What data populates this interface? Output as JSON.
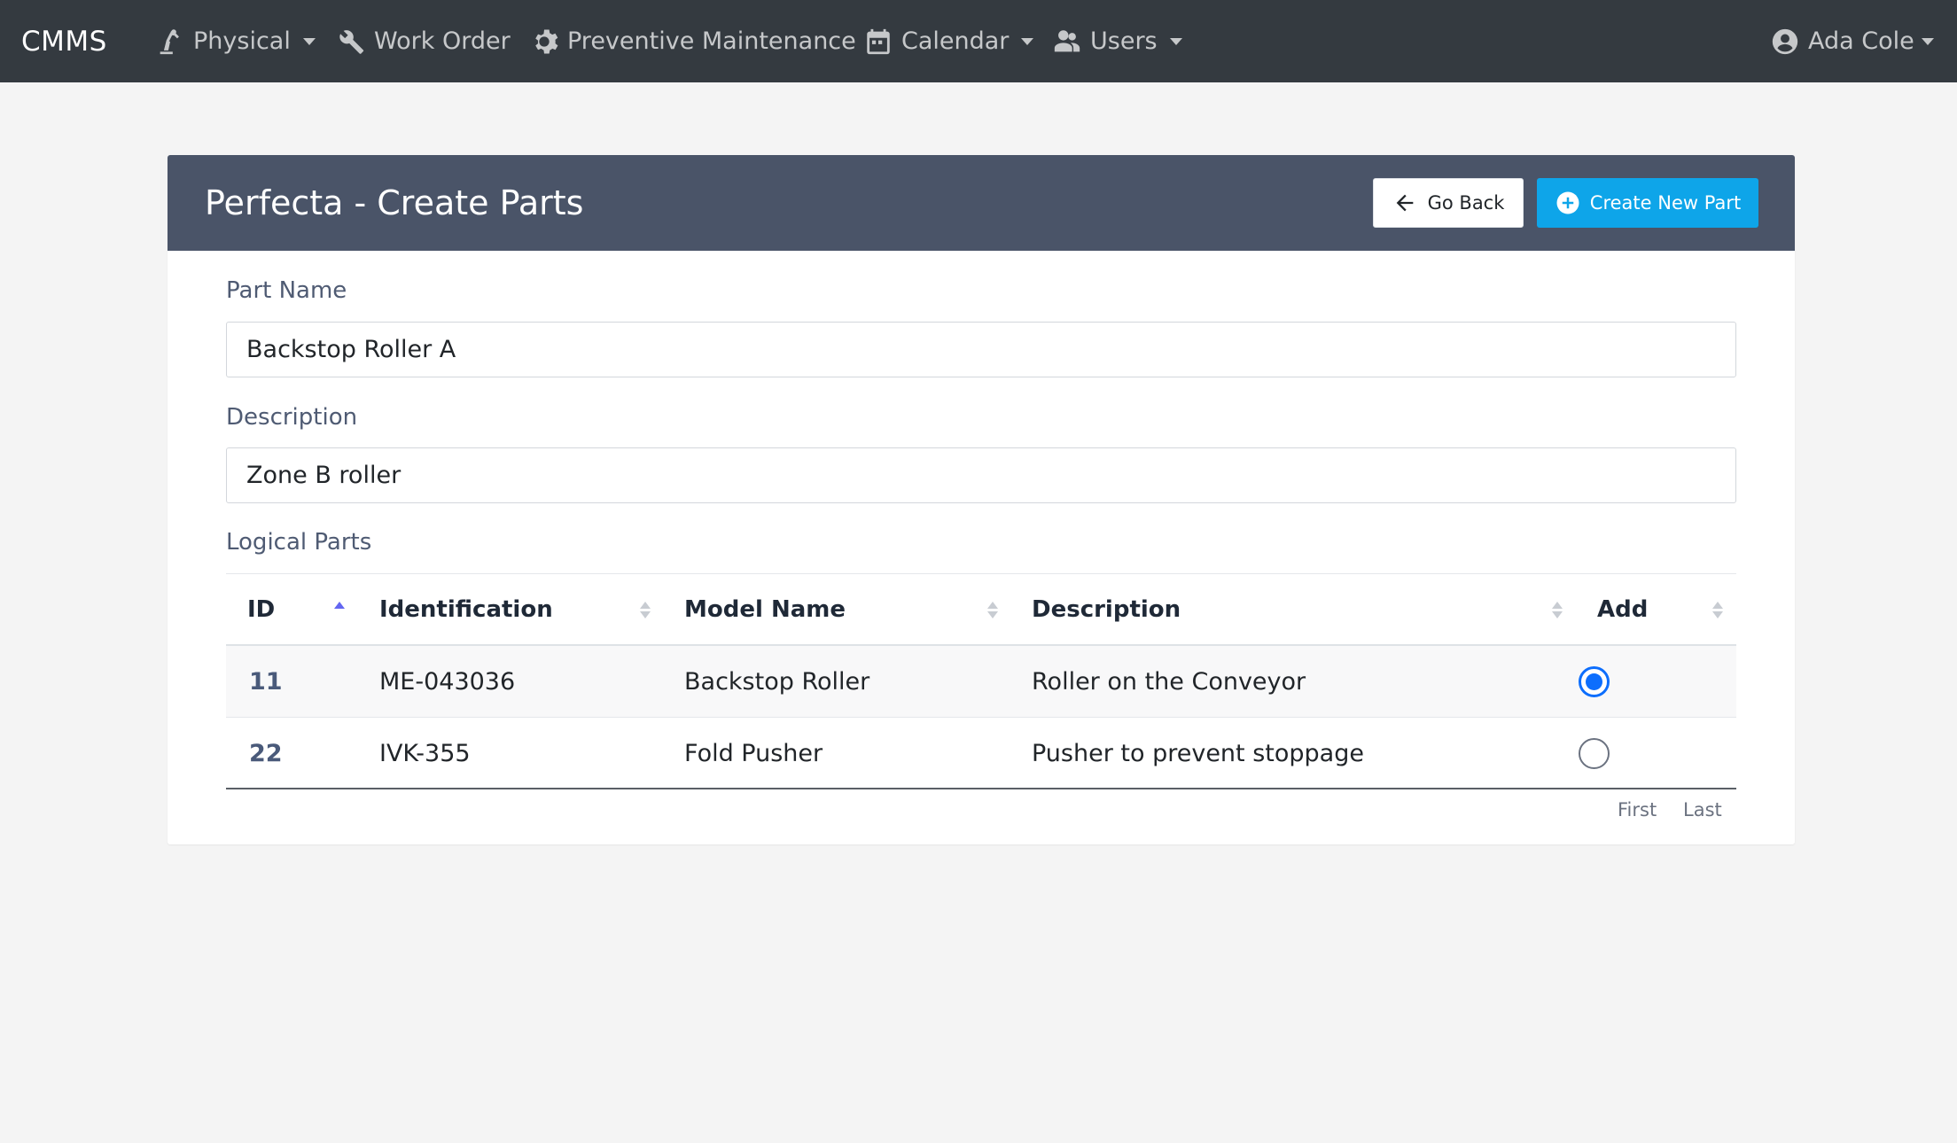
{
  "navbar": {
    "brand": "CMMS",
    "items": [
      {
        "label": "Physical",
        "icon": "robot-arm-icon",
        "dropdown": true
      },
      {
        "label": "Work Order",
        "icon": "tools-icon",
        "dropdown": false
      },
      {
        "label": "Preventive Maintenance",
        "icon": "gear-wrench-icon",
        "dropdown": false
      },
      {
        "label": "Calendar",
        "icon": "calendar-icon",
        "dropdown": true
      },
      {
        "label": "Users",
        "icon": "users-icon",
        "dropdown": true
      }
    ],
    "user": {
      "label": "Ada Cole",
      "icon": "user-circle-icon"
    }
  },
  "card": {
    "title": "Perfecta - Create Parts",
    "go_back_label": "Go Back",
    "create_label": "Create New Part"
  },
  "form": {
    "part_name_label": "Part Name",
    "part_name_value": "Backstop Roller A",
    "description_label": "Description",
    "description_value": "Zone B roller",
    "logical_parts_label": "Logical Parts"
  },
  "table": {
    "columns": [
      "ID",
      "Identification",
      "Model Name",
      "Description",
      "Add"
    ],
    "sorted_column": "ID",
    "sort_direction": "asc",
    "rows": [
      {
        "id": "11",
        "identification": "ME-043036",
        "model_name": "Backstop Roller",
        "description": "Roller on the Conveyor",
        "selected": true
      },
      {
        "id": "22",
        "identification": "IVK-355",
        "model_name": "Fold Pusher",
        "description": "Pusher to prevent stoppage",
        "selected": false
      }
    ],
    "pager": {
      "first": "First",
      "last": "Last"
    }
  },
  "colors": {
    "navbar_bg": "#343a40",
    "card_header_bg": "#4a5468",
    "create_button_bg": "#0ea5e9",
    "radio_checked": "#0d6efd",
    "sort_active": "#6366f1",
    "page_bg": "#f4f4f4"
  }
}
